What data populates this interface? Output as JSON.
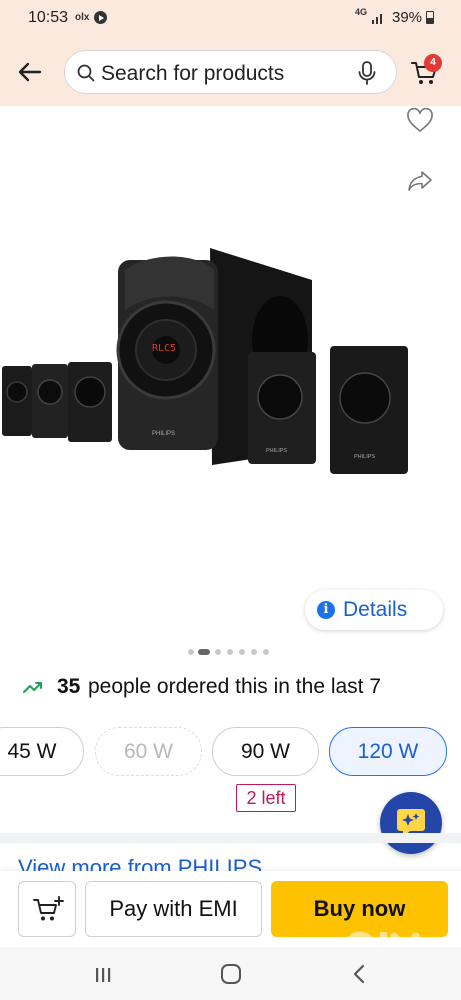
{
  "status_bar": {
    "time": "10:53",
    "olx_icon_label": "olx",
    "network": "4G",
    "battery": "39%"
  },
  "header": {
    "search_placeholder": "Search for products",
    "cart_count": "4"
  },
  "product": {
    "image_alt": "Philips multimedia speaker system",
    "details_label": "Details",
    "carousel": {
      "count": 7,
      "active_index": 1
    }
  },
  "social_proof": {
    "count": "35",
    "text": "people ordered this in the last 7"
  },
  "variants": {
    "options": [
      {
        "label": "45 W",
        "state": "normal"
      },
      {
        "label": "60 W",
        "state": "disabled"
      },
      {
        "label": "90 W",
        "state": "normal"
      },
      {
        "label": "120 W",
        "state": "selected"
      }
    ],
    "stock_note": "2 left"
  },
  "view_more": "View more from PHILIPS",
  "bottom_bar": {
    "emi_label": "Pay with EMI",
    "buy_label": "Buy now"
  },
  "colors": {
    "header_bg": "#fbe9dd",
    "accent_blue": "#1a5fd0",
    "buy_yellow": "#ffc200",
    "badge_red": "#e53935"
  },
  "icons": {
    "back": "arrow-left-icon",
    "search": "search-icon",
    "mic": "mic-icon",
    "cart": "cart-icon",
    "wishlist": "heart-icon",
    "share": "share-icon",
    "info": "info-icon",
    "trend": "trending-up-icon",
    "assistant": "ai-assistant-icon",
    "add_cart": "add-to-cart-icon"
  }
}
